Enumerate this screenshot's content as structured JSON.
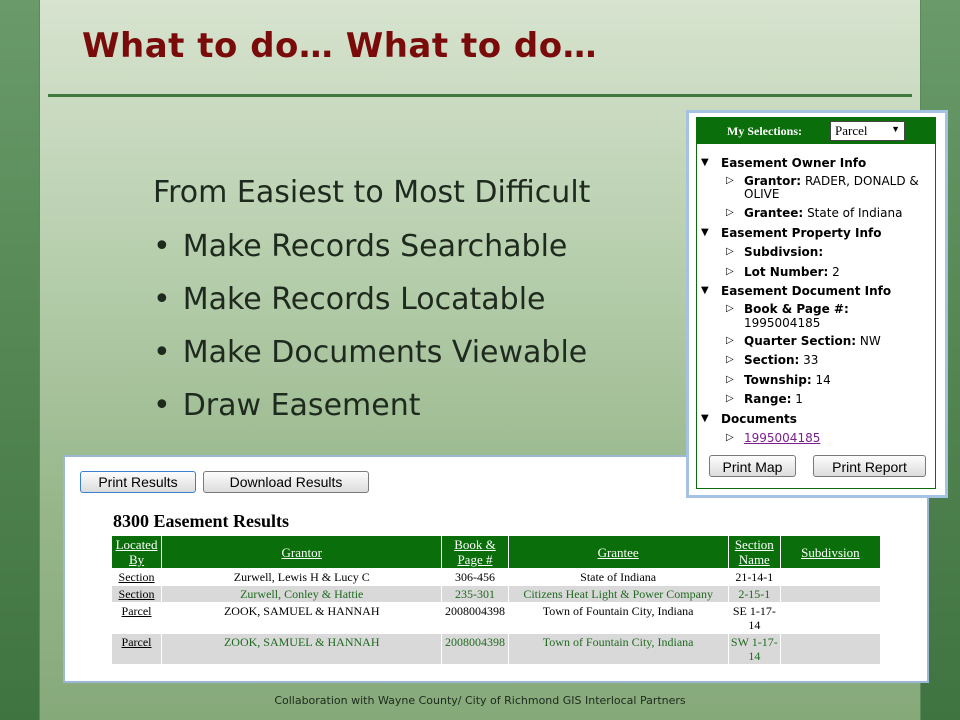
{
  "slide": {
    "title": "What to do… What to do…",
    "intro": "From Easiest to Most Difficult",
    "bullets": [
      "Make Records Searchable",
      "Make Records Locatable",
      "Make Documents Viewable",
      "Draw Easement"
    ],
    "footer": "Collaboration with Wayne County/ City of Richmond GIS Interlocal Partners"
  },
  "results": {
    "print_label": "Print Results",
    "download_label": "Download Results",
    "title": "8300 Easement Results",
    "columns": [
      "Located By",
      "Grantor",
      "Book & Page #",
      "Grantee",
      "Section Name",
      "Subdivsion"
    ],
    "rows": [
      [
        "Section",
        "Zurwell, Lewis H & Lucy C",
        "306-456",
        "State of Indiana",
        "21-14-1",
        ""
      ],
      [
        "Section",
        "Zurwell, Conley & Hattie",
        "235-301",
        "Citizens Heat Light & Power Company",
        "2-15-1",
        ""
      ],
      [
        "Parcel",
        "ZOOK, SAMUEL & HANNAH",
        "2008004398",
        "Town of Fountain City, Indiana",
        "SE 1-17-14",
        ""
      ],
      [
        "Parcel",
        "ZOOK, SAMUEL & HANNAH",
        "2008004398",
        "Town of Fountain City, Indiana",
        "SW 1-17-14",
        ""
      ]
    ]
  },
  "selections": {
    "header_label": "My Selections:",
    "dropdown_value": "Parcel",
    "owner_section": "Easement Owner Info",
    "grantor_label": "Grantor:",
    "grantor_value": "RADER, DONALD &",
    "grantor_value_2": "OLIVE",
    "grantee_label": "Grantee:",
    "grantee_value": "State of Indiana",
    "property_section": "Easement Property Info",
    "subdivision_label": "Subdivsion:",
    "lot_label": "Lot Number:",
    "lot_value": "2",
    "document_section": "Easement Document Info",
    "book_label": "Book & Page #:",
    "book_value": "1995004185",
    "quarter_label": "Quarter Section:",
    "quarter_value": "NW",
    "section_label": "Section:",
    "section_value": "33",
    "township_label": "Township:",
    "township_value": "14",
    "range_label": "Range:",
    "range_value": "1",
    "documents_section": "Documents",
    "document_link": "1995004185",
    "print_map_label": "Print Map",
    "print_report_label": "Print Report"
  }
}
